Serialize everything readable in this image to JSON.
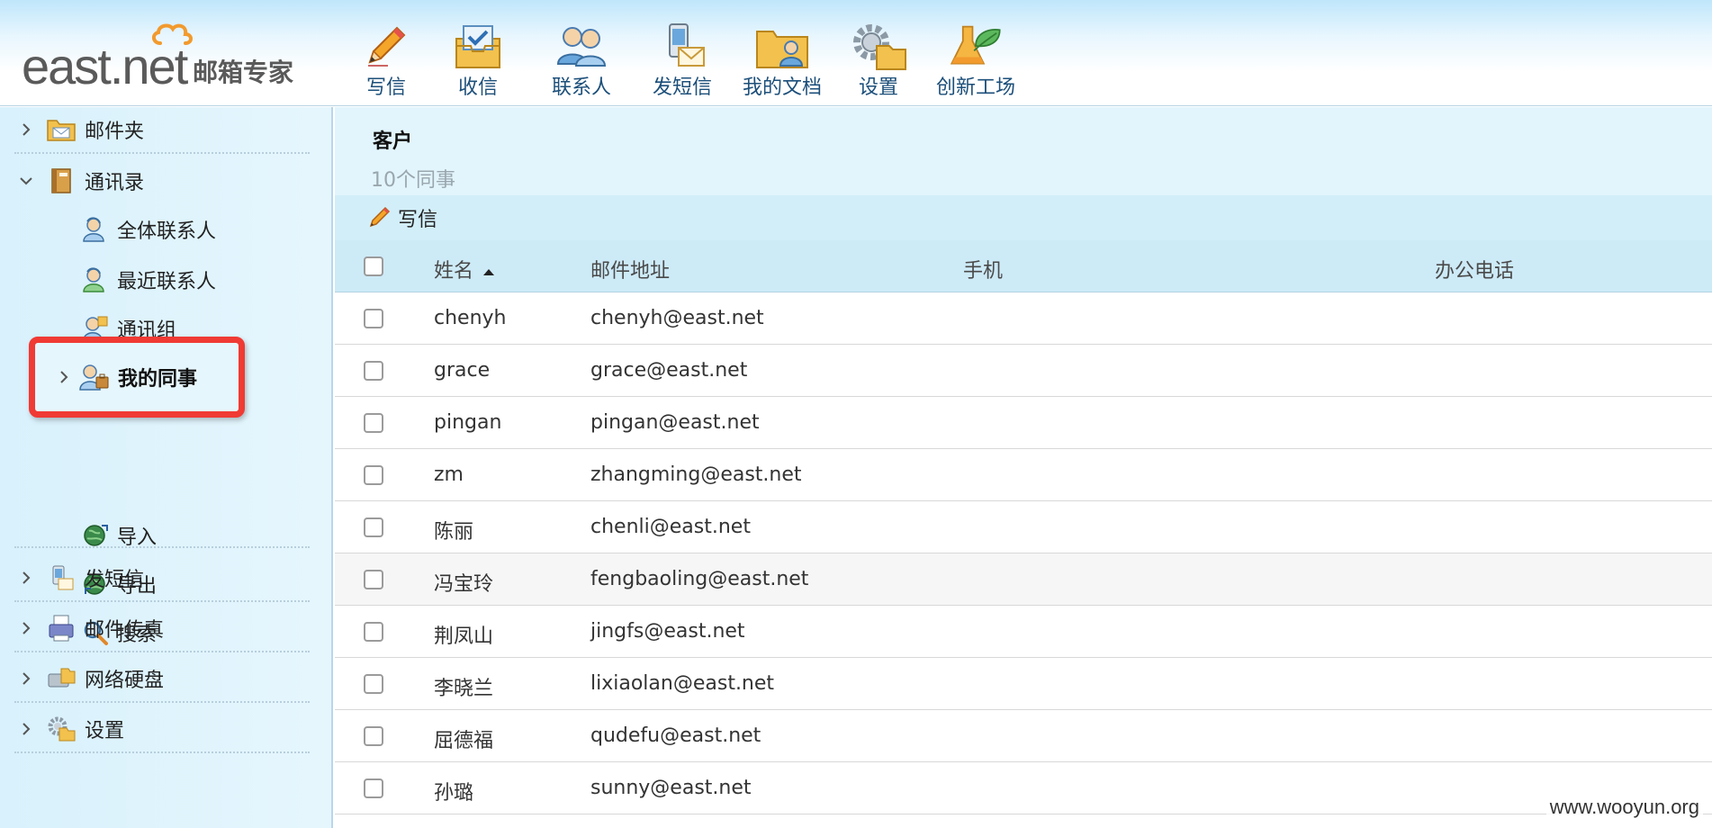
{
  "app": {
    "logo_main": "east.net",
    "logo_sub": "邮箱专家"
  },
  "toolbar": [
    {
      "label": "写信",
      "icon": "pencil-icon"
    },
    {
      "label": "收信",
      "icon": "inbox-icon"
    },
    {
      "label": "联系人",
      "icon": "contacts-icon"
    },
    {
      "label": "发短信",
      "icon": "sms-icon"
    },
    {
      "label": "我的文档",
      "icon": "documents-folder-icon"
    },
    {
      "label": "设置",
      "icon": "settings-gear-icon"
    },
    {
      "label": "创新工场",
      "icon": "flask-leaf-icon"
    }
  ],
  "sidebar": {
    "mail_folders": "邮件夹",
    "address_book": "通讯录",
    "all_contacts": "全体联系人",
    "recent_contacts": "最近联系人",
    "contact_groups": "通讯组",
    "my_colleagues": "我的同事",
    "import": "导入",
    "export": "导出",
    "search": "搜索",
    "send_sms": "发短信",
    "mail_fax": "邮件传真",
    "network_disk": "网络硬盘",
    "settings": "设置"
  },
  "main": {
    "group_title": "客户",
    "group_count": "10个同事",
    "write_label": "写信",
    "columns": {
      "name": "姓名",
      "email": "邮件地址",
      "mobile": "手机",
      "office_phone": "办公电话"
    },
    "sort": {
      "column": "name",
      "direction": "ascending"
    }
  },
  "rows": [
    {
      "name": "chenyh",
      "email": "chenyh@east.net",
      "mobile": "",
      "phone": ""
    },
    {
      "name": "grace",
      "email": "grace@east.net",
      "mobile": "",
      "phone": ""
    },
    {
      "name": "pingan",
      "email": "pingan@east.net",
      "mobile": "",
      "phone": ""
    },
    {
      "name": "zm",
      "email": "zhangming@east.net",
      "mobile": "",
      "phone": ""
    },
    {
      "name": "陈丽",
      "email": "chenli@east.net",
      "mobile": "",
      "phone": ""
    },
    {
      "name": "冯宝玲",
      "email": "fengbaoling@east.net",
      "mobile": "",
      "phone": ""
    },
    {
      "name": "荆凤山",
      "email": "jingfs@east.net",
      "mobile": "",
      "phone": ""
    },
    {
      "name": "李晓兰",
      "email": "lixiaolan@east.net",
      "mobile": "",
      "phone": ""
    },
    {
      "name": "屈德福",
      "email": "qudefu@east.net",
      "mobile": "",
      "phone": ""
    },
    {
      "name": "孙璐",
      "email": "sunny@east.net",
      "mobile": "",
      "phone": ""
    }
  ],
  "watermark": "www.wooyun.org",
  "colors": {
    "highlight_border": "#f03a34",
    "sidebar_bg": "#e0f4fc",
    "toolbar_label": "#1c4f7a"
  }
}
